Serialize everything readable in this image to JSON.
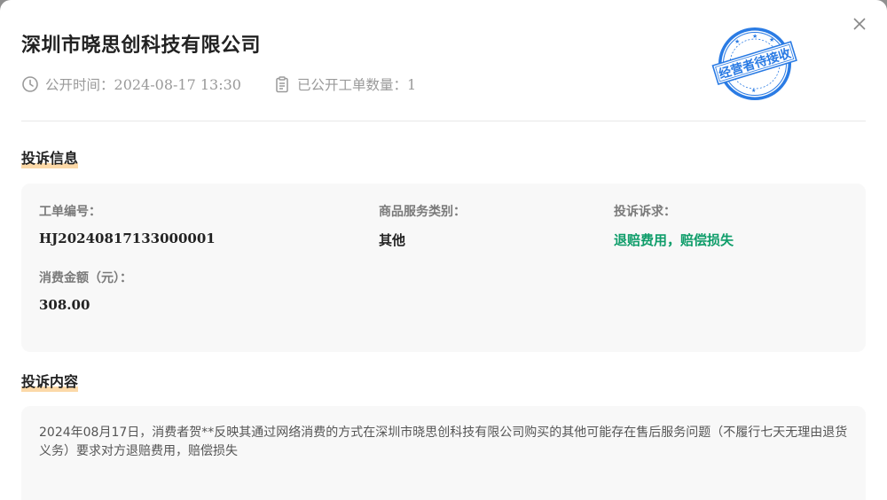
{
  "header": {
    "company_name": "深圳市晓思创科技有限公司",
    "publish_time_label": "公开时间：",
    "publish_time_value": "2024-08-17 13:30",
    "ticket_count_label": "已公开工单数量：",
    "ticket_count_value": "1",
    "stamp_text": "经营者待接收",
    "stamp_color": "#2a7be4",
    "close_icon": "close-icon"
  },
  "complaint_info": {
    "section_title": "投诉信息",
    "ticket_no_label": "工单编号：",
    "ticket_no_value": "HJ20240817133000001",
    "category_label": "商品服务类别：",
    "category_value": "其他",
    "demand_label": "投诉诉求：",
    "demand_value": "退赔费用，赔偿损失",
    "demand_color": "#0f9d6a",
    "amount_label": "消费金额（元）：",
    "amount_value": "308.00"
  },
  "complaint_content": {
    "section_title": "投诉内容",
    "text": "2024年08月17日，消费者贺**反映其通过网络消费的方式在深圳市晓思创科技有限公司购买的其他可能存在售后服务问题（不履行七天无理由退货义务）要求对方退赔费用，赔偿损失"
  },
  "colors": {
    "accent_underline": "#fcd9a8",
    "card_background": "#f8f8f8"
  }
}
